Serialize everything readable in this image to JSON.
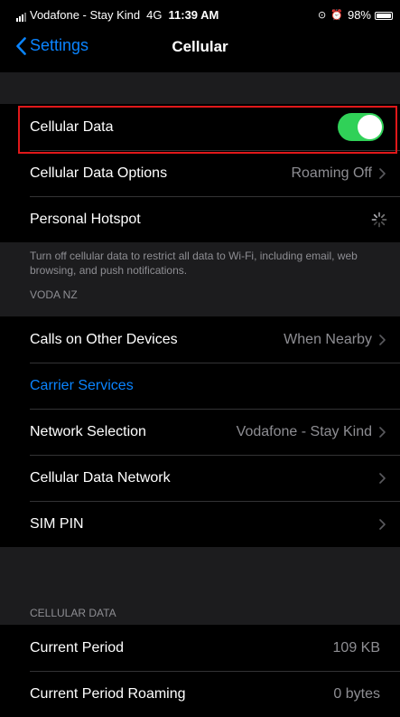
{
  "status_bar": {
    "carrier": "Vodafone - Stay Kind",
    "network": "4G",
    "time": "11:39 AM",
    "battery": "98%"
  },
  "nav": {
    "back_label": "Settings",
    "title": "Cellular"
  },
  "cellular_data": {
    "label": "Cellular Data",
    "enabled": true
  },
  "rows_group1": [
    {
      "label": "Cellular Data Options",
      "value": "Roaming Off"
    },
    {
      "label": "Personal Hotspot",
      "value": ""
    }
  ],
  "footer_text": "Turn off cellular data to restrict all data to Wi-Fi, including email, web browsing, and push notifications.",
  "carrier_section": {
    "header": "VODA NZ",
    "rows": [
      {
        "label": "Calls on Other Devices",
        "value": "When Nearby"
      },
      {
        "label": "Carrier Services",
        "value": ""
      },
      {
        "label": "Network Selection",
        "value": "Vodafone - Stay Kind"
      },
      {
        "label": "Cellular Data Network",
        "value": ""
      },
      {
        "label": "SIM PIN",
        "value": ""
      }
    ]
  },
  "usage_section": {
    "header": "CELLULAR DATA",
    "rows": [
      {
        "label": "Current Period",
        "value": "109 KB"
      },
      {
        "label": "Current Period Roaming",
        "value": "0 bytes"
      }
    ]
  },
  "colors": {
    "accent": "#0a84ff",
    "toggle_on": "#30d158",
    "highlight": "#e0181a"
  }
}
